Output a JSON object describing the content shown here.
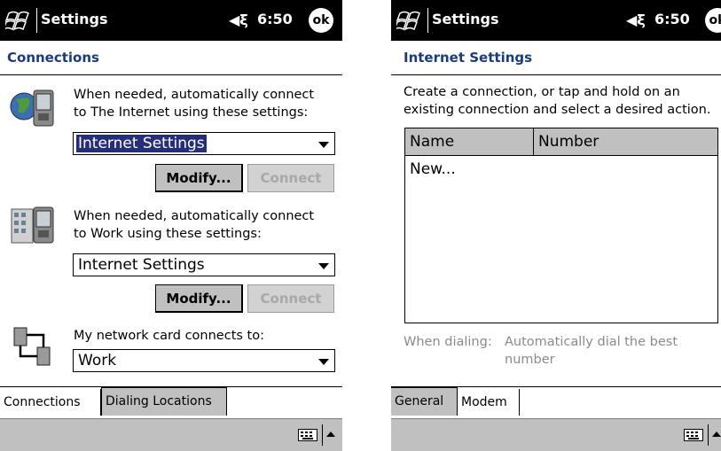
{
  "left": {
    "titlebar": {
      "title": "Settings",
      "volume": "◀ξ",
      "time": "6:50",
      "ok": "ok"
    },
    "header": "Connections",
    "internet": {
      "text1": "When needed, automatically connect",
      "text2": "to The Internet using these settings:",
      "combo_value": "Internet Settings",
      "modify": "Modify...",
      "connect": "Connect"
    },
    "work": {
      "text1": "When needed, automatically connect",
      "text2": "to Work using these settings:",
      "combo_value": "Internet Settings",
      "modify": "Modify...",
      "connect": "Connect"
    },
    "network": {
      "label": "My network card connects to:",
      "combo_value": "Work"
    },
    "tabs": [
      "Connections",
      "Dialing Locations"
    ]
  },
  "right": {
    "titlebar": {
      "title": "Settings",
      "volume": "◀ξ",
      "time": "6:50",
      "ok": "ok"
    },
    "header": "Internet Settings",
    "instructions1": "Create a connection, or tap and hold on an",
    "instructions2": "existing connection and select a desired action.",
    "list": {
      "columns": [
        "Name",
        "Number"
      ],
      "rows": [
        "New..."
      ]
    },
    "dialing": {
      "label": "When dialing:",
      "value1": "Automatically dial the best",
      "value2": "number"
    },
    "tabs": [
      "General",
      "Modem"
    ]
  }
}
